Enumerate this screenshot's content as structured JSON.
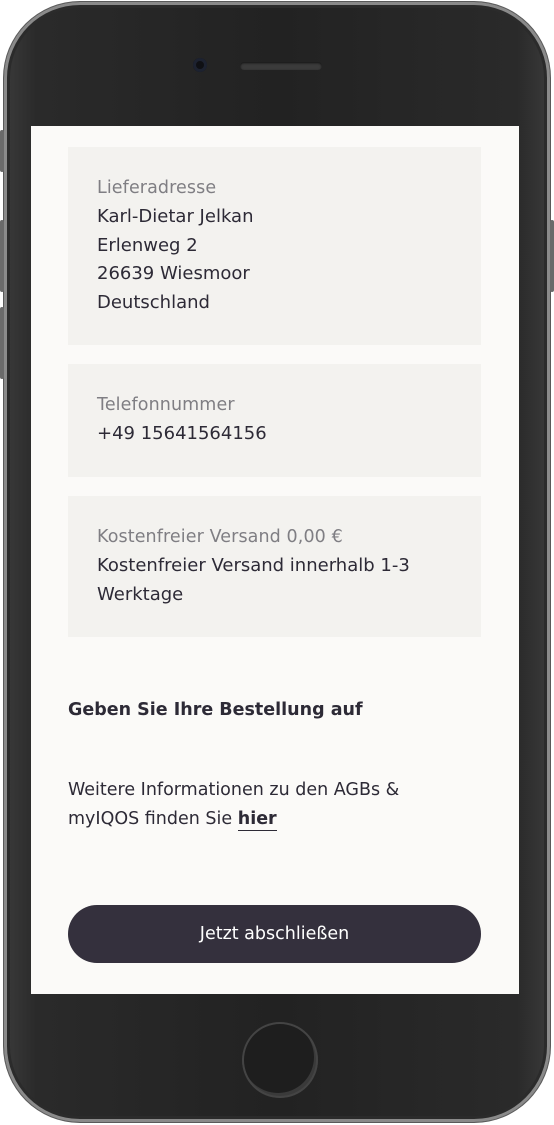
{
  "delivery_address": {
    "label": "Lieferadresse",
    "name": "Karl-Dietar Jelkan",
    "street": "Erlenweg 2",
    "city": "26639 Wiesmoor",
    "country": "Deutschland"
  },
  "phone_number": {
    "label": "Telefonnummer",
    "value": "+49 15641564156"
  },
  "shipping": {
    "label": "Kostenfreier Versand 0,00 €",
    "line1": "Kostenfreier Versand innerhalb 1-3",
    "line2": "Werktage"
  },
  "order": {
    "title": "Geben Sie Ihre Bestellung auf",
    "info_line1": "Weitere Informationen zu den AGBs &",
    "info_line2_prefix": "myIQOS finden Sie ",
    "info_link": "hier",
    "submit_label": "Jetzt abschließen"
  },
  "colors": {
    "background": "#fbfaf8",
    "card": "#f3f2ef",
    "text": "#2d2a36",
    "muted": "#7f7e83",
    "button": "#34303d"
  }
}
